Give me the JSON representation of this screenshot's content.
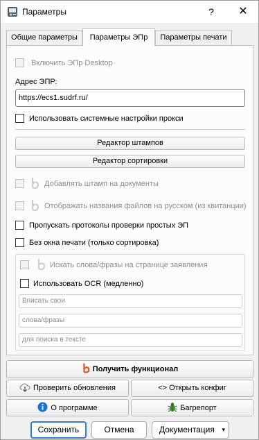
{
  "window": {
    "title": "Параметры",
    "help": "?",
    "close": "✕"
  },
  "tabs": [
    {
      "label": "Общие параметры",
      "active": false
    },
    {
      "label": "Параметры ЭПр",
      "active": true
    },
    {
      "label": "Параметры печати",
      "active": false
    }
  ],
  "epr": {
    "enable_desktop": {
      "label": "Включить ЭПр Desktop",
      "checked": false,
      "enabled": false
    },
    "address_label": "Адрес ЭПР:",
    "address_value": "https://ecs1.sudrf.ru/",
    "use_system_proxy": {
      "label": "Использовать системные настройки прокси",
      "checked": false
    },
    "stamp_editor_button": "Редактор штампов",
    "sort_editor_button": "Редактор сортировки",
    "add_stamp": {
      "label": "Добавлять штамп на документы",
      "checked": false,
      "enabled": false
    },
    "russian_filenames": {
      "label": "Отображать названия файлов на русском (из квитанции)",
      "checked": false,
      "enabled": false
    },
    "skip_protocols": {
      "label": "Пропускать протоколы проверки простых ЭП",
      "checked": false
    },
    "no_print_window": {
      "label": "Без окна печати (только сортировка)",
      "checked": false
    },
    "search_words": {
      "label": "Искать слова/фразы на странице заявления",
      "checked": false,
      "enabled": false
    },
    "use_ocr": {
      "label": "Использовать OCR (медленно)",
      "checked": false
    },
    "placeholders": [
      "Вписать свои",
      "слова/фразы",
      "для поиска в тексте"
    ]
  },
  "actions": {
    "get_features": "Получить функционал",
    "check_updates": "Проверить обновления",
    "open_config": "<> Открыть конфиг",
    "about": "О программе",
    "bug_report": "Багрепорт"
  },
  "dialog": {
    "save": "Сохранить",
    "cancel": "Отмена",
    "docs": "Документация",
    "docs_arrow": "▾"
  },
  "colors": {
    "accent": "#3a78d6",
    "brand_icon": "#e2552b",
    "info_icon": "#1f6fd1",
    "bug_icon": "#3f8f2f"
  }
}
